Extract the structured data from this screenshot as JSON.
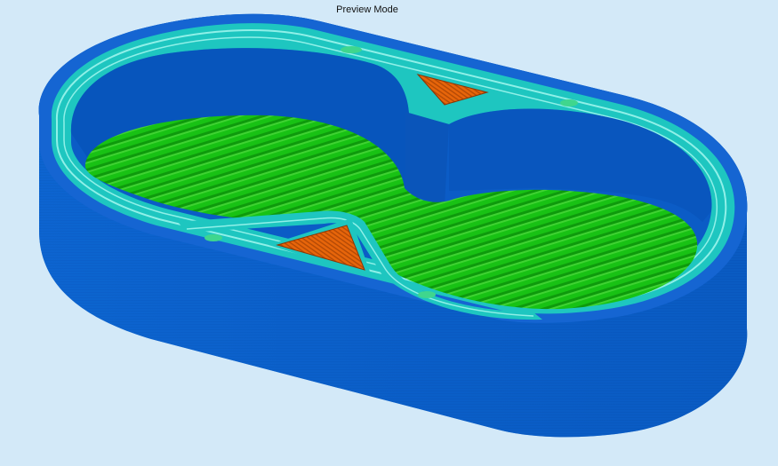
{
  "viewport": {
    "mode_label": "Preview Mode"
  },
  "colors": {
    "background": "#d3e9f8",
    "outer_wall": "#0a5ec8",
    "outer_wall_dark": "#0650b4",
    "wall_top": "#1565d2",
    "perimeter_cyan": "#1ec6c0",
    "perimeter_light": "#8ff0e8",
    "infill_green": "#18c214",
    "infill_dark": "#0e9a0c",
    "support_orange": "#e7650a",
    "support_dark": "#b44a06"
  }
}
